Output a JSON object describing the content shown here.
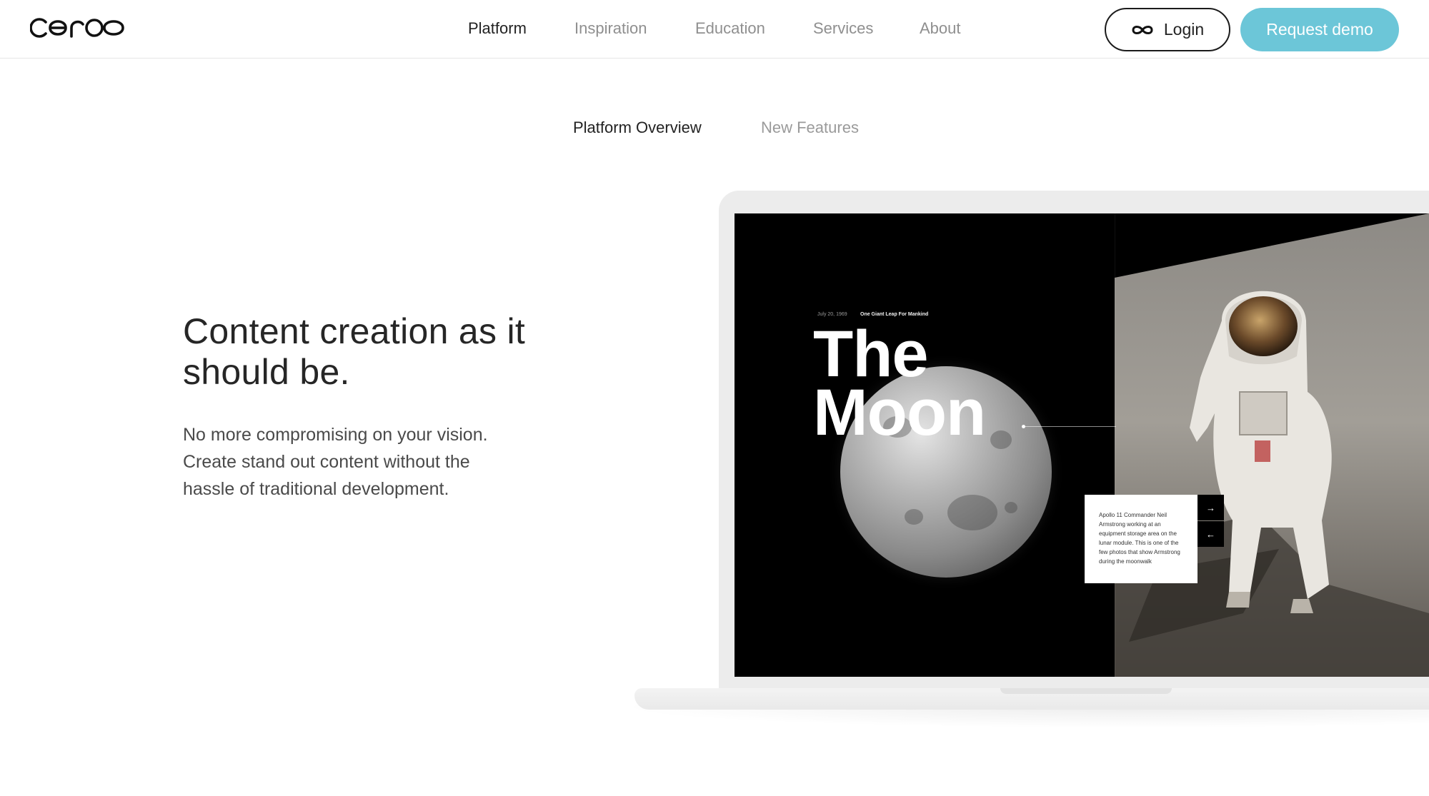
{
  "brand": {
    "name": "ceros",
    "accent_color": "#6cc6d8"
  },
  "nav": {
    "items": [
      {
        "label": "Platform",
        "active": true
      },
      {
        "label": "Inspiration",
        "active": false
      },
      {
        "label": "Education",
        "active": false
      },
      {
        "label": "Services",
        "active": false
      },
      {
        "label": "About",
        "active": false
      }
    ],
    "login_label": "Login",
    "login_icon": "infinity-icon",
    "demo_label": "Request demo"
  },
  "subnav": {
    "tabs": [
      {
        "label": "Platform Overview",
        "active": true
      },
      {
        "label": "New Features",
        "active": false
      }
    ]
  },
  "hero": {
    "title": "Content creation as it should be.",
    "body": "No more compromising on your vision. Create stand out content without the hassle of traditional development."
  },
  "preview": {
    "date": "July 20, 1969",
    "tagline": "One Giant Leap For Mankind",
    "title_line1": "The",
    "title_line2": "Moon",
    "caption": "Apollo 11 Commander Neil Armstrong working at an equipment storage area on the lunar module. This is one of the few photos that show Armstrong during the moonwalk",
    "next_icon": "arrow-right-icon",
    "prev_icon": "arrow-left-icon"
  }
}
